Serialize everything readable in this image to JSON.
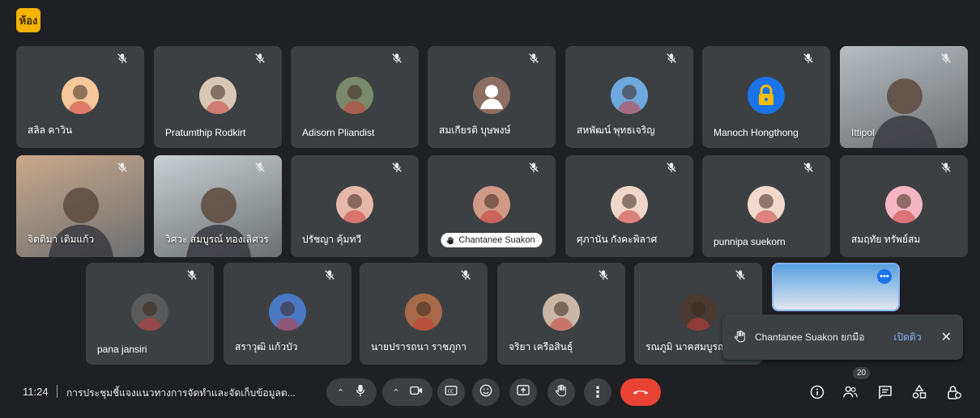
{
  "app": {
    "logo_text": "ห้อง"
  },
  "participants": [
    {
      "name": "สลิล คาวิน",
      "type": "avatar",
      "color": "#f6c79b"
    },
    {
      "name": "Pratumthip Rodkirt",
      "type": "avatar",
      "color": "#d9c7b5"
    },
    {
      "name": "Adisorn Pliandist",
      "type": "avatar",
      "color": "#7a8a6a"
    },
    {
      "name": "สมเกียรติ บุษพงษ์",
      "type": "default-avatar",
      "color": "#8d6e63"
    },
    {
      "name": "สหพัฒน์ พุทธเจริญ",
      "type": "avatar",
      "color": "#6fa8dc"
    },
    {
      "name": "Manoch Hongthong",
      "type": "lock-avatar",
      "color": "#1a73e8"
    },
    {
      "name": "Ittipol",
      "type": "video",
      "color": "#b7bcc0"
    },
    {
      "name": "จิตติมา เติมแก้ว",
      "type": "video",
      "color": "#caa88a"
    },
    {
      "name": "วิศวะ สมบูรณ์ ทองเลิศวร",
      "type": "video",
      "color": "#c9cfd2"
    },
    {
      "name": "ปรัชญา คุ้มทวี",
      "type": "avatar",
      "color": "#e6b8a8"
    },
    {
      "name": "Chantanee Suakon",
      "type": "avatar",
      "color": "#d09a86",
      "highlight": true
    },
    {
      "name": "ศุภานัน กังคะพิลาศ",
      "type": "avatar",
      "color": "#f0d6c8"
    },
    {
      "name": "punnipa suekorn",
      "type": "avatar",
      "color": "#f2d9cc"
    },
    {
      "name": "สมฤทัย ทรัพย์สม",
      "type": "avatar",
      "color": "#f4b6c2"
    },
    {
      "name": "pana jansiri",
      "type": "avatar",
      "color": "#5a5a5a"
    },
    {
      "name": "สราวุฒิ แก้วบัว",
      "type": "avatar",
      "color": "#4a78c2"
    },
    {
      "name": "นายปรารถนา ราชภูกา",
      "type": "avatar",
      "color": "#a66a4a"
    },
    {
      "name": "จริยา เครือสินธุ์",
      "type": "avatar",
      "color": "#c9b6a4"
    },
    {
      "name": "รณภูมิ นาคสมบูรณ์",
      "type": "avatar",
      "color": "#4a3a32"
    },
    {
      "name": "",
      "type": "screen",
      "color": "#5aa0e0"
    }
  ],
  "notification": {
    "text": "Chantanee Suakon ยกมือ",
    "action": "เปิดดิว",
    "close": "✕"
  },
  "bottom_bar": {
    "time": "11:24",
    "meeting_title": "การประชุมชี้แจงแนวทางการจัดทำและจัดเก็บข้อมูลต...",
    "participant_count": "20"
  },
  "colors": {
    "background": "#1f2023",
    "tile": "#3c4043",
    "end_call": "#ea4335",
    "link": "#8ab4f8"
  },
  "icons": [
    "mic-off-icon",
    "mic-icon",
    "camera-icon",
    "captions-icon",
    "emoji-icon",
    "present-icon",
    "raise-hand-icon",
    "more-icon",
    "end-call-icon",
    "info-icon",
    "people-icon",
    "chat-icon",
    "activities-icon",
    "host-controls-icon"
  ]
}
